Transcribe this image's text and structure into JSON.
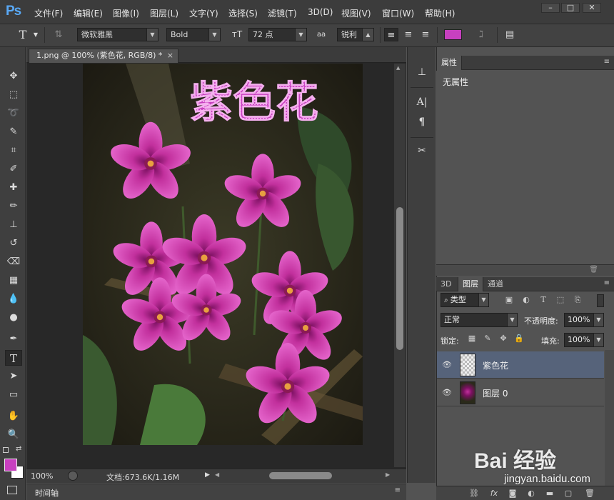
{
  "app": {
    "logo": "Ps"
  },
  "menu": [
    "文件(F)",
    "编辑(E)",
    "图像(I)",
    "图层(L)",
    "文字(Y)",
    "选择(S)",
    "滤镜(T)",
    "3D(D)",
    "视图(V)",
    "窗口(W)",
    "帮助(H)"
  ],
  "options": {
    "tool_icon": "T",
    "font_family": "微软雅黑",
    "font_style": "Bold",
    "font_size": "72 点",
    "aa_label": "aa",
    "antialias": "锐利",
    "text_color": "#c840c0"
  },
  "document": {
    "tab_title": "1.png @ 100% (紫色花, RGB/8) *",
    "overlay_text": "紫色花",
    "zoom": "100%",
    "doc_info": "文档:673.6K/1.16M"
  },
  "timeline": {
    "label": "时间轴"
  },
  "properties": {
    "tab": "属性",
    "body": "无属性"
  },
  "layers_panel": {
    "tabs": [
      "3D",
      "图层",
      "通道"
    ],
    "filter": "类型",
    "blend_mode": "正常",
    "opacity_label": "不透明度:",
    "opacity": "100%",
    "lock_label": "锁定:",
    "fill_label": "填充:",
    "fill": "100%",
    "layers": [
      {
        "name": "紫色花",
        "selected": true
      },
      {
        "name": "图层 0",
        "selected": false
      }
    ]
  },
  "colors": {
    "foreground": "#c840c0",
    "background": "#ffffff",
    "accent": "#59a9f6"
  },
  "watermark": {
    "brand": "Bai 经验",
    "url": "jingyan.baidu.com"
  }
}
